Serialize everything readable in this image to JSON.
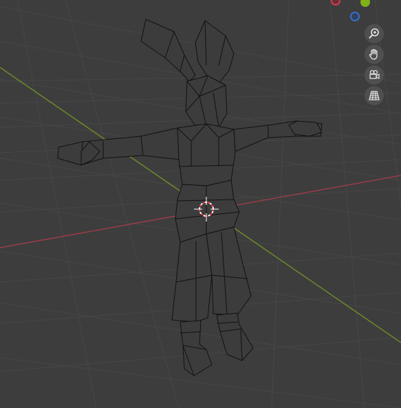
{
  "viewport": {
    "background": "#3d3d3d",
    "grid_color": "#474747",
    "x_axis_color": "#9a3c48",
    "y_axis_color": "#6c8b2a",
    "mesh_wire_color": "#111111",
    "mesh_fill_color": "#3c3c3c"
  },
  "gizmo": {
    "x_axis": {
      "color": "#d33a4f",
      "icon": "x-axis-gizmo-dot"
    },
    "y_axis": {
      "color": "#7fb219",
      "icon": "y-axis-gizmo-dot"
    },
    "z_axis": {
      "color": "#3a6fc6",
      "icon": "z-axis-gizmo-dot"
    }
  },
  "nav_buttons": [
    {
      "name": "zoom",
      "icon": "zoom-in-icon"
    },
    {
      "name": "pan",
      "icon": "hand-icon"
    },
    {
      "name": "camera",
      "icon": "camera-icon"
    },
    {
      "name": "perspective",
      "icon": "grid-icon"
    }
  ],
  "cursor": {
    "outer_color": "#ff4040",
    "inner_color": "#ffffff"
  }
}
